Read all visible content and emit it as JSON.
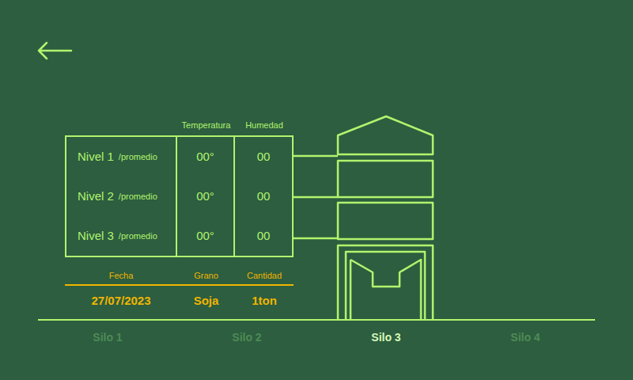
{
  "table": {
    "columns": [
      "Temperatura",
      "Humedad"
    ],
    "rows": [
      {
        "level": "Nivel 1",
        "suffix": "/promedio",
        "temperature": "00°",
        "humidity": "00"
      },
      {
        "level": "Nivel 2",
        "suffix": "/promedio",
        "temperature": "00°",
        "humidity": "00"
      },
      {
        "level": "Nivel 3",
        "suffix": "/promedio",
        "temperature": "00°",
        "humidity": "00"
      }
    ]
  },
  "details": {
    "columns": [
      "Fecha",
      "Grano",
      "Cantidad"
    ],
    "values": [
      "27/07/2023",
      "Soja",
      "1ton"
    ]
  },
  "silos": [
    {
      "label": "Silo 1",
      "selected": false
    },
    {
      "label": "Silo 2",
      "selected": false
    },
    {
      "label": "Silo 3",
      "selected": true
    },
    {
      "label": "Silo 4",
      "selected": false
    }
  ]
}
